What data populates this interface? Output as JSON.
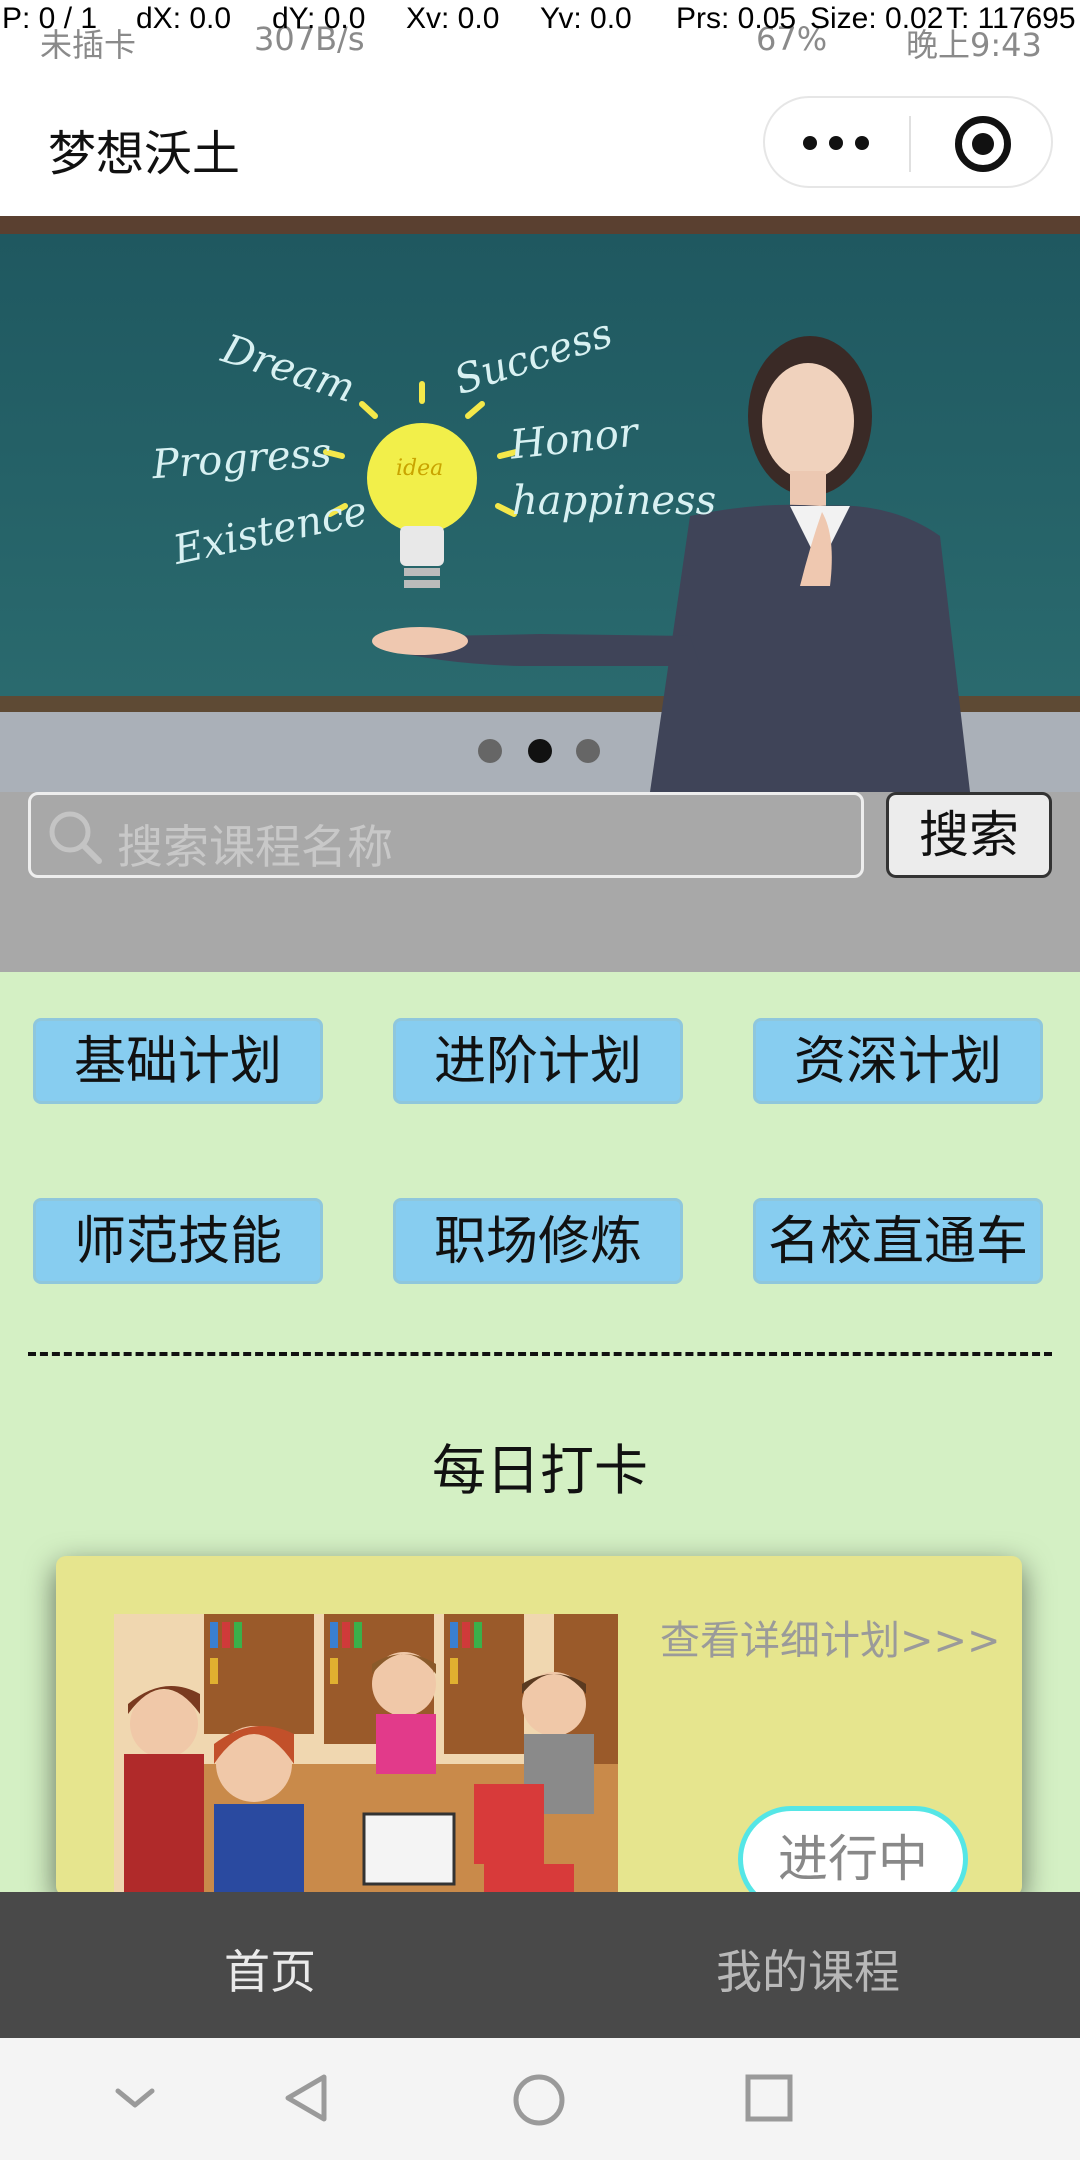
{
  "status_bar": {
    "debug": {
      "pointer": "P: 0 / 1",
      "dx": "dX: 0.0",
      "dy": "dY: 0.0",
      "xv": "Xv: 0.0",
      "yv": "Yv: 0.0",
      "prs": "Prs: 0.05",
      "size": "Size: 0.02",
      "t": "T: 117695"
    },
    "carrier": "未插卡",
    "net_speed": "307B/s",
    "battery": "67%",
    "time": "晚上9:43"
  },
  "title_bar": {
    "title": "梦想沃土",
    "more_icon": "more-dots-icon",
    "close_icon": "target-close-icon"
  },
  "banner": {
    "words": [
      "Dream",
      "Success",
      "Progress",
      "Honor",
      "Existence",
      "happiness",
      "idea"
    ],
    "dots_count": 3,
    "active_dot": 2
  },
  "search": {
    "placeholder": "搜索课程名称",
    "button": "搜索"
  },
  "categories": [
    "基础计划",
    "进阶计划",
    "资深计划",
    "师范技能",
    "职场修炼",
    "名校直通车"
  ],
  "daily": {
    "title": "每日打卡",
    "card": {
      "link": "查看详细计划>>>",
      "status": "进行中"
    }
  },
  "tabbar": {
    "home": "首页",
    "my_courses": "我的课程"
  },
  "colors": {
    "page_bg": "#d4f0c4",
    "category_button": "#87cdf0",
    "card_bg": "#e6e58e",
    "tabbar_bg": "#494949",
    "status_pill_border": "#55e6e6"
  }
}
